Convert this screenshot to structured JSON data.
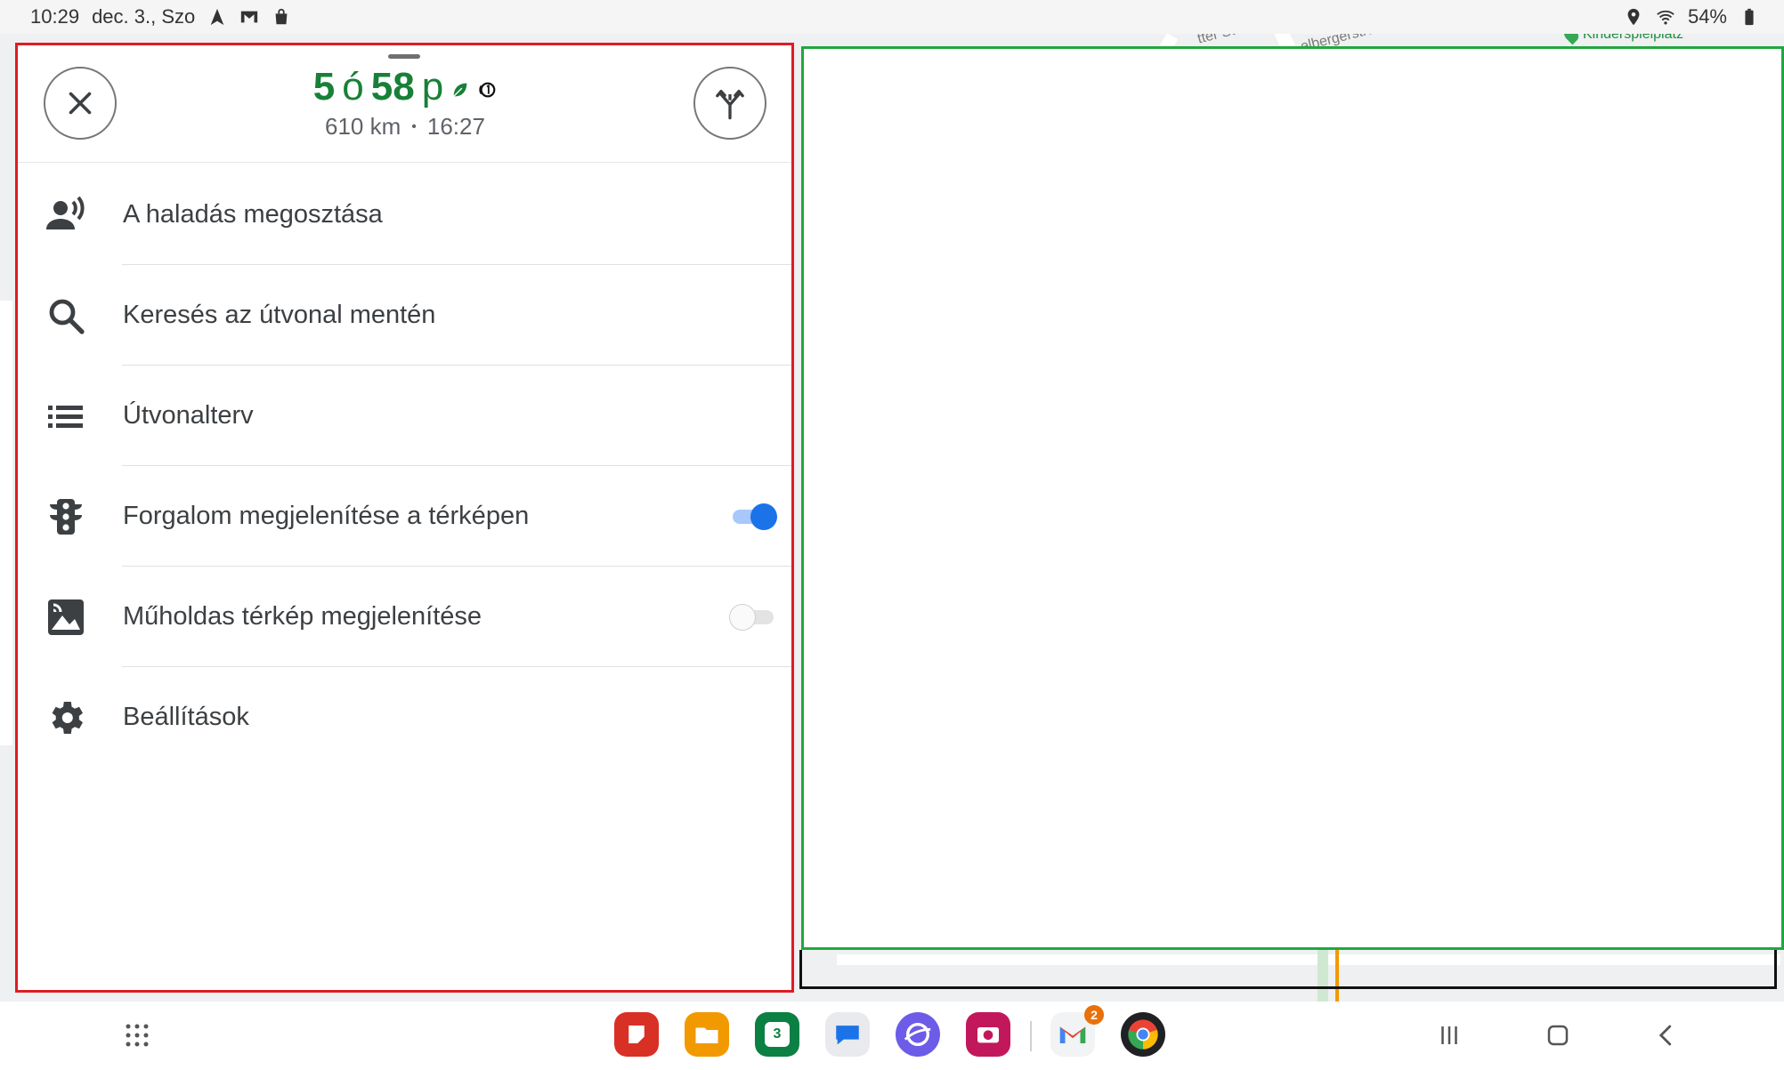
{
  "status_bar": {
    "time": "10:29",
    "date": "dec. 3., Szo",
    "battery": "54%",
    "icons_left": [
      "navigation-arrow-icon",
      "gmail-icon",
      "shopping-bag-icon"
    ],
    "icons_right": [
      "location-icon",
      "wifi-icon",
      "battery-icon"
    ]
  },
  "map": {
    "poi": "Kinderspielplatz"
  },
  "panel": {
    "eta": {
      "hours": "5",
      "hour_unit": "ó",
      "minutes": "58",
      "minute_unit": "p",
      "distance": "610 km",
      "separator": "•",
      "arrival": "16:27"
    },
    "menu": [
      {
        "label": "A haladás megosztása",
        "icon": "share-progress-icon"
      },
      {
        "label": "Keresés az útvonal mentén",
        "icon": "search-icon"
      },
      {
        "label": "Útvonalterv",
        "icon": "list-icon"
      },
      {
        "label": "Forgalom megjelenítése a térképen",
        "icon": "traffic-light-icon",
        "toggle": true
      },
      {
        "label": "Műholdas térkép megjelenítése",
        "icon": "satellite-icon",
        "toggle": false
      },
      {
        "label": "Beállítások",
        "icon": "gear-icon"
      }
    ]
  },
  "navbar": {
    "apps": [
      "app-drawer",
      "sticky-notes",
      "files",
      "calendar",
      "messages",
      "internet",
      "camera",
      "gmail",
      "chrome"
    ],
    "calendar_day": "3",
    "gmail_badge": "2",
    "colors": {
      "accent_green": "#188038",
      "toggle_blue": "#1a73e8"
    }
  }
}
